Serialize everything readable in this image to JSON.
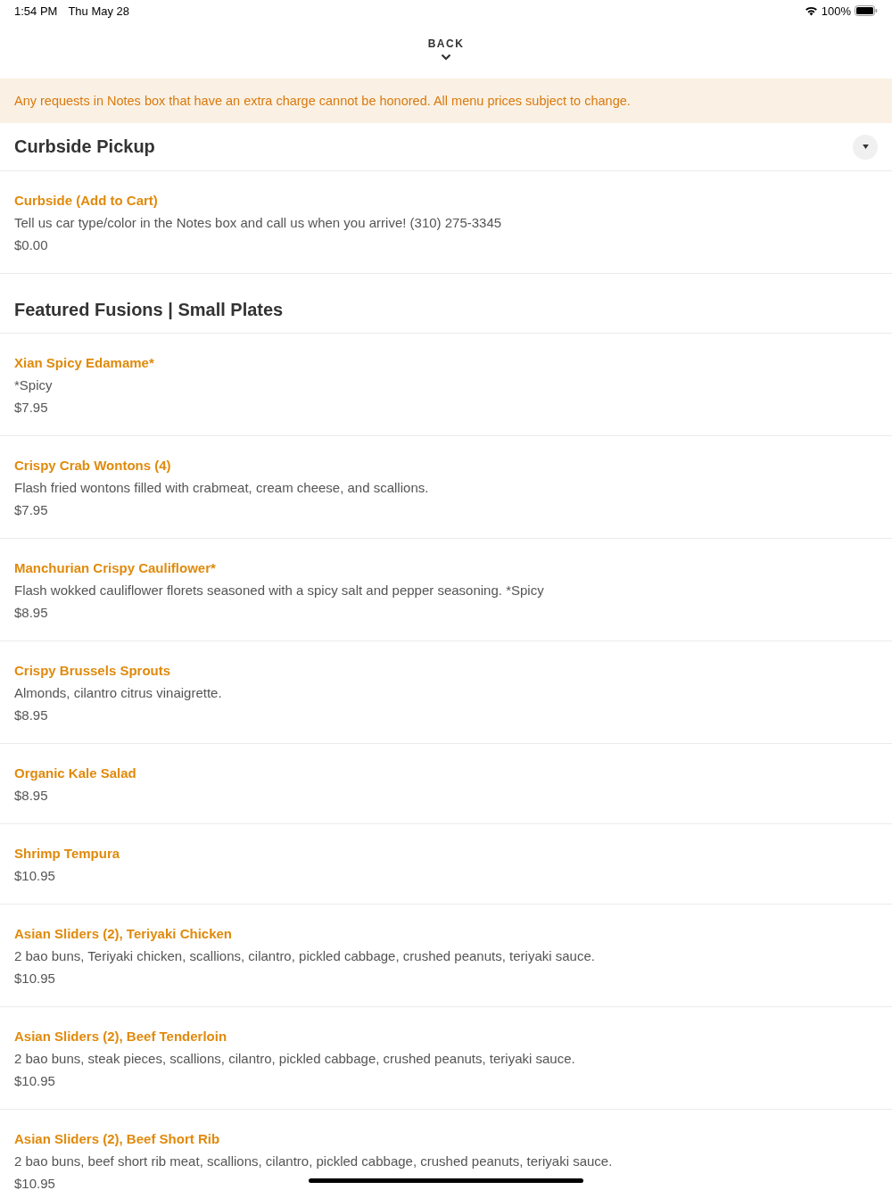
{
  "status_bar": {
    "time": "1:54 PM",
    "date": "Thu May 28",
    "battery": "100%"
  },
  "back": {
    "label": "BACK"
  },
  "notice": "Any requests in Notes box that have an extra charge cannot be honored. All menu prices subject to change.",
  "sections": [
    {
      "title": "Curbside Pickup",
      "collapsible": true,
      "items": [
        {
          "name": "Curbside (Add to Cart)",
          "description": "Tell us car type/color in the Notes box and call us when you arrive! (310) 275-3345",
          "price": "$0.00"
        }
      ]
    },
    {
      "title": "Featured Fusions | Small Plates",
      "collapsible": false,
      "items": [
        {
          "name": "Xian Spicy Edamame*",
          "description": "*Spicy",
          "price": "$7.95"
        },
        {
          "name": "Crispy Crab Wontons (4)",
          "description": "Flash fried wontons filled with crabmeat, cream cheese, and scallions.",
          "price": "$7.95"
        },
        {
          "name": "Manchurian Crispy Cauliflower*",
          "description": "Flash wokked cauliflower florets seasoned with a spicy salt and pepper seasoning. *Spicy",
          "price": "$8.95"
        },
        {
          "name": "Crispy Brussels Sprouts",
          "description": "Almonds, cilantro citrus vinaigrette.",
          "price": "$8.95"
        },
        {
          "name": "Organic Kale Salad",
          "price": "$8.95"
        },
        {
          "name": "Shrimp Tempura",
          "price": "$10.95"
        },
        {
          "name": "Asian Sliders (2), Teriyaki Chicken",
          "description": "2 bao buns, Teriyaki chicken, scallions, cilantro, pickled cabbage, crushed peanuts, teriyaki sauce.",
          "price": "$10.95"
        },
        {
          "name": "Asian Sliders (2), Beef Tenderloin",
          "description": "2 bao buns, steak pieces, scallions, cilantro, pickled cabbage, crushed peanuts, teriyaki sauce.",
          "price": "$10.95"
        },
        {
          "name": "Asian Sliders (2), Beef Short Rib",
          "description": "2 bao buns, beef short rib meat, scallions, cilantro, pickled cabbage, crushed peanuts, teriyaki sauce.",
          "price": "$10.95"
        }
      ]
    }
  ]
}
